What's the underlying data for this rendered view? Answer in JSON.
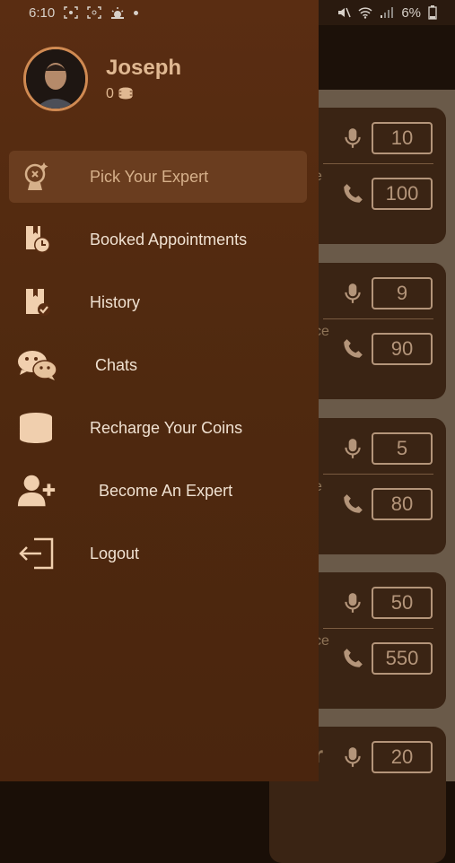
{
  "status_bar": {
    "time": "6:10",
    "battery_text": "6%"
  },
  "profile": {
    "name": "Joseph",
    "coins": "0"
  },
  "menu": [
    {
      "label": "Pick Your Expert",
      "icon": "pick-expert-icon",
      "active": true
    },
    {
      "label": "Booked Appointments",
      "icon": "booked-appointments-icon"
    },
    {
      "label": "History",
      "icon": "history-icon"
    },
    {
      "label": "Chats",
      "icon": "chats-icon"
    },
    {
      "label": "Recharge Your Coins",
      "icon": "coins-icon"
    },
    {
      "label": "Become An Expert",
      "icon": "add-user-icon"
    },
    {
      "label": "Logout",
      "icon": "logout-icon"
    }
  ],
  "background_cards": [
    {
      "voice_price": "10",
      "call_price": "100",
      "fragment": "e"
    },
    {
      "voice_price": "9",
      "call_price": "90",
      "fragment": "ce"
    },
    {
      "voice_price": "5",
      "call_price": "80",
      "fragment": "e"
    },
    {
      "voice_price": "50",
      "call_price": "550",
      "fragment": "ce"
    },
    {
      "voice_price": "20",
      "call_price": "",
      "fragment": "r"
    }
  ],
  "colors": {
    "drawer": "#5a2d12",
    "accent_text": "#e0b892",
    "active_item_bg": "#6a3d1f",
    "menu_text": "#f0e1d1"
  }
}
